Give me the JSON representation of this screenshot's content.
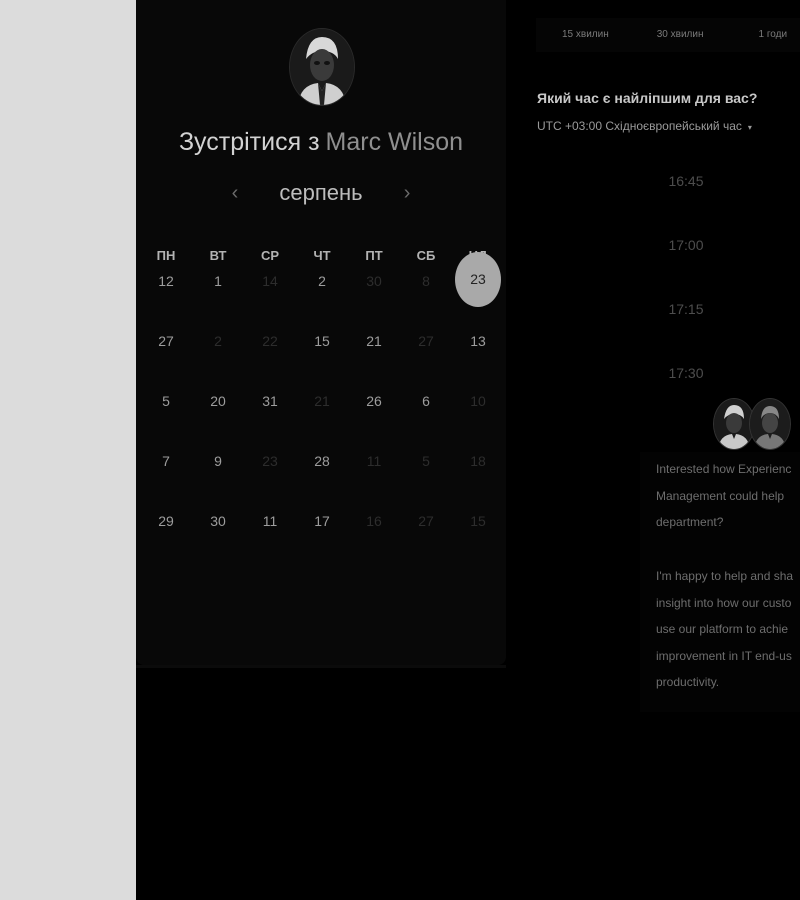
{
  "host": {
    "title_prefix": "Зустрітися з",
    "name": "Marc Wilson"
  },
  "calendar": {
    "month": "серпень",
    "prev_icon": "‹",
    "next_icon": "›",
    "weekdays": [
      "ПН",
      "ВТ",
      "СР",
      "ЧТ",
      "ПТ",
      "СБ",
      "НД"
    ],
    "selected_day": "23",
    "weeks": [
      [
        {
          "d": "12",
          "a": true
        },
        {
          "d": "1",
          "a": true
        },
        {
          "d": "14",
          "a": false
        },
        {
          "d": "2",
          "a": true
        },
        {
          "d": "30",
          "a": false
        },
        {
          "d": "8",
          "a": false
        }
      ],
      [
        {
          "d": "27",
          "a": true
        },
        {
          "d": "2",
          "a": false
        },
        {
          "d": "22",
          "a": false
        },
        {
          "d": "15",
          "a": true
        },
        {
          "d": "21",
          "a": true
        },
        {
          "d": "27",
          "a": false
        },
        {
          "d": "13",
          "a": true
        }
      ],
      [
        {
          "d": "5",
          "a": true
        },
        {
          "d": "20",
          "a": true
        },
        {
          "d": "31",
          "a": true
        },
        {
          "d": "21",
          "a": false
        },
        {
          "d": "26",
          "a": true
        },
        {
          "d": "6",
          "a": true
        },
        {
          "d": "10",
          "a": false
        }
      ],
      [
        {
          "d": "7",
          "a": true
        },
        {
          "d": "9",
          "a": true
        },
        {
          "d": "23",
          "a": false
        },
        {
          "d": "28",
          "a": true
        },
        {
          "d": "11",
          "a": false
        },
        {
          "d": "5",
          "a": false
        },
        {
          "d": "18",
          "a": false
        }
      ],
      [
        {
          "d": "29",
          "a": true
        },
        {
          "d": "30",
          "a": true
        },
        {
          "d": "11",
          "a": true
        },
        {
          "d": "17",
          "a": true
        },
        {
          "d": "16",
          "a": false
        },
        {
          "d": "27",
          "a": false
        },
        {
          "d": "15",
          "a": false
        }
      ]
    ]
  },
  "durations": [
    "15 хвилин",
    "30 хвилин",
    "1 годи"
  ],
  "question": "Який час є найліпшим для вас?",
  "timezone": "UTC +03:00 Східноєвропейський час",
  "timezone_caret": "▾",
  "slots": [
    "16:45",
    "17:00",
    "17:15",
    "17:30"
  ],
  "chat": {
    "lines_1": [
      "Interested how Experienc",
      "Management could help",
      "department?"
    ],
    "lines_2": [
      "I'm happy to help and sha",
      "insight into how our custo",
      "use our platform to achie",
      "improvement in IT end-us",
      "productivity."
    ]
  },
  "colors": {
    "background": "#000000",
    "panel": "#080808",
    "selected": "#a9a9a9",
    "gutter": "#dcdcdc"
  }
}
